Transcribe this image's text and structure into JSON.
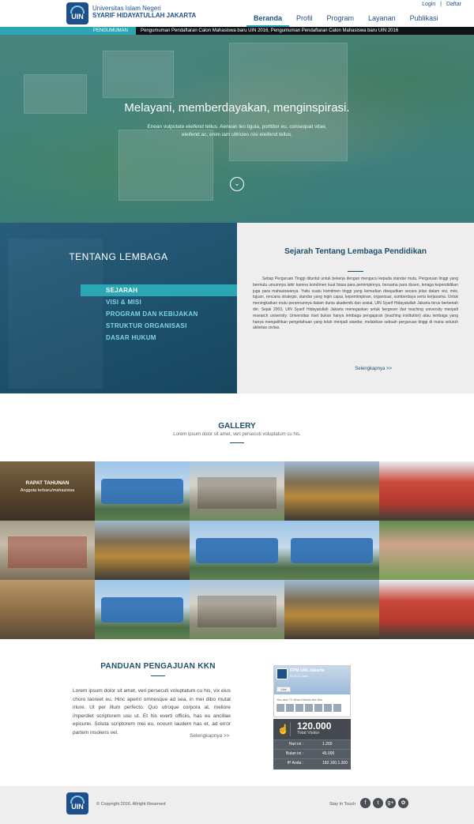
{
  "header": {
    "logo_text": "UIN",
    "brand_line1": "Universitas Islam Negeri",
    "brand_line2": "SYARIF HIDAYATULLAH JAKARTA",
    "login": "Login",
    "separator": "|",
    "register": "Daftar",
    "nav": [
      "Beranda",
      "Profil",
      "Program",
      "Layanan",
      "Publikasi"
    ]
  },
  "announcement": {
    "tag": "PENGUMUMAN",
    "message": "Pengumuman Pendaftaran Calon Mahasiswa baru UIN 2016, Pengumuman Pendaftaran Calon Mahasiswa baru UIN 2016"
  },
  "hero": {
    "headline": "Melayani, memberdayakan, menginspirasi.",
    "subtext": "Enean vulputate eleifend tellus. Aenean leo ligula, porttitor eu, consequat vitae, eleifend ac, enim iam ultricies nisi eleifend tellus.",
    "scroll_icon": "chevron-down-icon"
  },
  "about": {
    "title": "TENTANG LEMBAGA",
    "menu": [
      "SEJARAH",
      "VISI & MISI",
      "PROGRAM DAN KEBIJAKAN",
      "STRUKTUR ORGANISASI",
      "DASAR HUKUM"
    ],
    "article_title": "Sejarah Tentang Lembaga Pendidikan",
    "article_body": "Setiap Perguruan Tinggi dituntut untuk bekerja dengan mengacu kepada standar mutu. Perguruan tinggi yang bermutu umumnya lahir karena komitmen kuat biasa para pemimpinnya, bersama para dosen, tenaga kependidikan juga para mahasiswanya. Yaitu suatu komitmen tinggi yang kemudian diwujudkan secara jelas dalam visi, misi, tujuan, rencana strategis, standar yang ingin capai, kepemimpinan, organisasi, sumberdaya serta kerjasama. Untuk meningkatkan mutu perannannya dalam dunia akademik dan sosial, UIN Syarif Hidayatullah Jakarta terus berbenah diri. Sejak 2003, UIN Syarif Hidayatullah Jakarta menegaskan untuk bergeser dari teaching university menjadi research university. Universitas riset bukan hanya lembaga pengajaran (teaching institution) atau lembaga yang hanya mengalihkan pengetahuan yang telah menjadi standar, melainkan sebuah perguruan tinggi di mana seluruh aktivitas civitas.",
    "read_more": "Selengkapnya >>"
  },
  "gallery": {
    "title": "GALLERY",
    "subtitle": "Lorem ipsum dolor sit amet, veri persecuti voluptatum cu his.",
    "featured_title": "RAPAT TAHUNAN",
    "featured_sub": "Anggota terbaru/mahasiswa"
  },
  "kkn": {
    "title": "PANDUAN PENGAJUAN KKN",
    "body": "Lorem ipsum dolor sit amet, veri persecuti voluptatum cu his, vix eius choro laoreet eu. Hinc aperiri omnesque ad sea, in mei dibo mutat iriure. Ut per illum perfecto. Quo utroque corpora at, meliore imperdiet scriptorem usu ut. Et his everti officiis, has eu ancillae epicurei. Soluta scriptorem mei eu, novum laudem has et, ad error partem insolens vel.",
    "read_more": "Selengkapnya >>"
  },
  "facebook": {
    "page_name": "FPM UIN Jakarta",
    "likes": "99,872 Likes",
    "like_button": "Like",
    "friends_text": "You and 72 other friends like this"
  },
  "visitor": {
    "total": "120.000",
    "label": "Total Visitor",
    "rows": [
      {
        "key": "Hari ini :",
        "value": "1.200"
      },
      {
        "key": "Bulan ini :",
        "value": "45.000"
      },
      {
        "key": "IP Anda :",
        "value": "192.160.1.300"
      }
    ]
  },
  "footer": {
    "logo_text": "UIN",
    "copyright": "© Copyright 2016. Allright Reserved",
    "stay": "Stay In Touch",
    "social": [
      "f",
      "t",
      "g+",
      "✿"
    ]
  },
  "colors": {
    "accent": "#2aa6b4",
    "navy": "#1e4f8a",
    "dark_teal": "#20506a"
  }
}
